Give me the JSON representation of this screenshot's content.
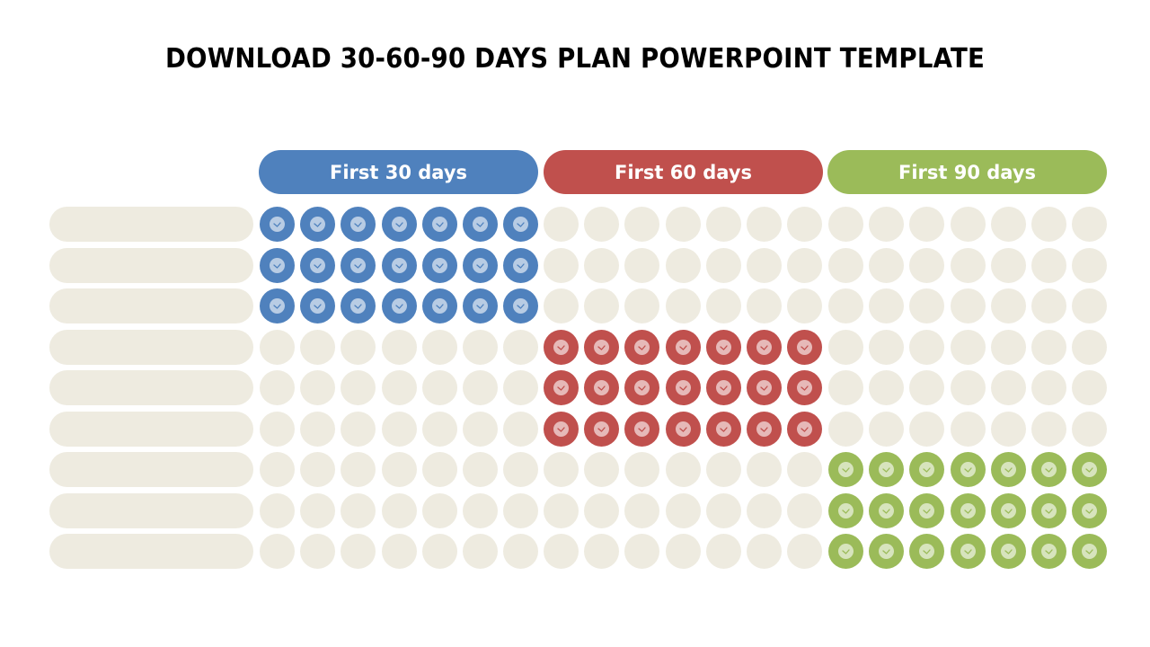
{
  "title": "DOWNLOAD 30-60-90 DAYS PLAN POWERPOINT TEMPLATE",
  "headers": [
    {
      "label": "First 30 days",
      "color": "#4f81bd",
      "light": "#b8cce4"
    },
    {
      "label": "First 60 days",
      "color": "#c0504d",
      "light": "#e6b9b8"
    },
    {
      "label": "First 90 days",
      "color": "#9bbb59",
      "light": "#d7e4bd"
    }
  ],
  "empty_color": "#eeebe0",
  "rows": 9,
  "columns_per_phase": 7,
  "task_labels": [
    "",
    "",
    "",
    "",
    "",
    "",
    "",
    "",
    ""
  ],
  "active_phase_by_row": [
    0,
    0,
    0,
    1,
    1,
    1,
    2,
    2,
    2
  ]
}
